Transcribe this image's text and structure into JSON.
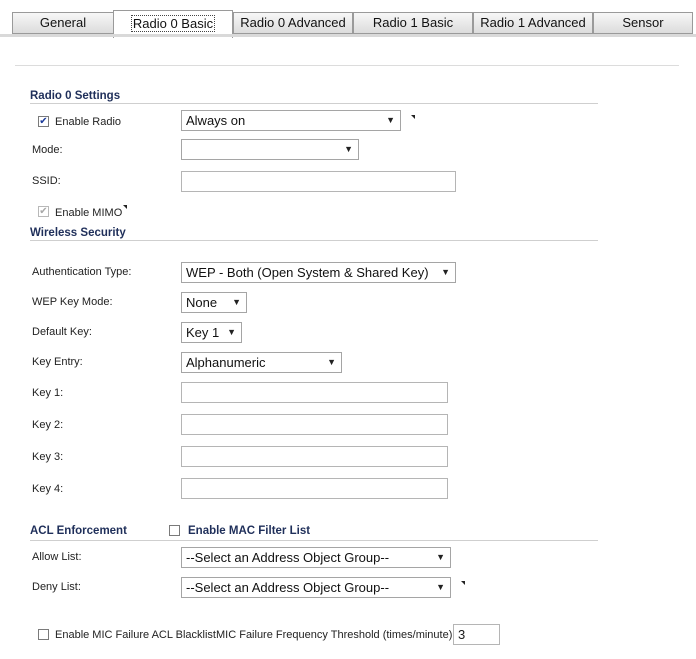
{
  "tabs": [
    "General",
    "Radio 0 Basic",
    "Radio 0 Advanced",
    "Radio 1 Basic",
    "Radio 1 Advanced",
    "Sensor"
  ],
  "active_tab": "Radio 0 Basic",
  "radio_settings": {
    "title": "Radio 0 Settings",
    "enable_radio_label": "Enable Radio",
    "enable_radio_checked": true,
    "schedule_value": "Always on",
    "mode_label": "Mode:",
    "mode_value": "",
    "ssid_label": "SSID:",
    "ssid_value": "",
    "enable_mimo_label": "Enable MIMO",
    "enable_mimo_checked": true
  },
  "wireless_security": {
    "title": "Wireless Security",
    "auth_label": "Authentication Type:",
    "auth_value": "WEP - Both (Open System & Shared Key)",
    "wep_key_mode_label": "WEP Key Mode:",
    "wep_key_mode_value": "None",
    "default_key_label": "Default Key:",
    "default_key_value": "Key 1",
    "key_entry_label": "Key Entry:",
    "key_entry_value": "Alphanumeric",
    "key1_label": "Key 1:",
    "key2_label": "Key 2:",
    "key3_label": "Key 3:",
    "key4_label": "Key 4:"
  },
  "acl": {
    "title": "ACL Enforcement",
    "enable_mac_filter_label": "Enable MAC Filter List",
    "enable_mac_filter_checked": false,
    "allow_label": "Allow List:",
    "allow_value": "--Select an Address Object Group--",
    "deny_label": "Deny List:",
    "deny_value": "--Select an Address Object Group--",
    "mic_blacklist_label": "Enable MIC Failure ACL Blacklist",
    "mic_blacklist_checked": false,
    "mic_threshold_label": "MIC Failure Frequency Threshold (times/minute):",
    "mic_threshold_value": "3"
  },
  "icons": {
    "dropdown": "chevron-down-icon",
    "check": "checkmark-icon",
    "help": "help-triangle-icon"
  }
}
